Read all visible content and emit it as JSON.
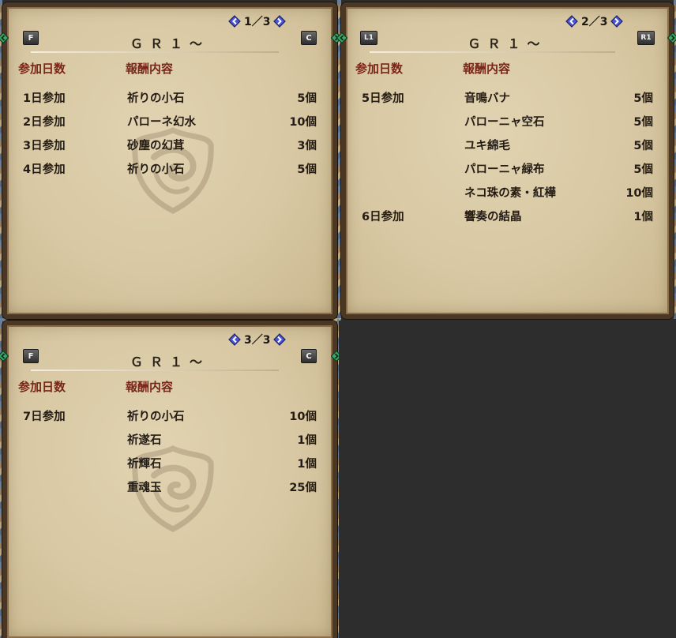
{
  "panels": [
    {
      "title": "ＧＲ１～",
      "page": "1／3",
      "left_key": "F",
      "right_key": "C",
      "col_day": "参加日数",
      "col_reward": "報酬内容",
      "rows": [
        {
          "day": "1日参加",
          "item": "祈りの小石",
          "qty": "5個"
        },
        {
          "day": "2日参加",
          "item": "パローネ幻水",
          "qty": "10個"
        },
        {
          "day": "3日参加",
          "item": "砂塵の幻茸",
          "qty": "3個"
        },
        {
          "day": "4日参加",
          "item": "祈りの小石",
          "qty": "5個"
        }
      ]
    },
    {
      "title": "ＧＲ１～",
      "page": "2／3",
      "left_key": "L1",
      "right_key": "R1",
      "col_day": "参加日数",
      "col_reward": "報酬内容",
      "rows": [
        {
          "day": "5日参加",
          "item": "音鳴バナ",
          "qty": "5個"
        },
        {
          "day": "",
          "item": "パローニャ空石",
          "qty": "5個"
        },
        {
          "day": "",
          "item": "ユキ綿毛",
          "qty": "5個"
        },
        {
          "day": "",
          "item": "パローニャ緑布",
          "qty": "5個"
        },
        {
          "day": "",
          "item": "ネコ珠の素・紅樺",
          "qty": "10個"
        },
        {
          "day": "6日参加",
          "item": "響奏の結晶",
          "qty": "1個"
        }
      ]
    },
    {
      "title": "ＧＲ１～",
      "page": "3／3",
      "left_key": "F",
      "right_key": "C",
      "col_day": "参加日数",
      "col_reward": "報酬内容",
      "rows": [
        {
          "day": "7日参加",
          "item": "祈りの小石",
          "qty": "10個"
        },
        {
          "day": "",
          "item": "祈遂石",
          "qty": "1個"
        },
        {
          "day": "",
          "item": "祈輝石",
          "qty": "1個"
        },
        {
          "day": "",
          "item": "重魂玉",
          "qty": "25個"
        }
      ]
    }
  ],
  "colors": {
    "header_text": "#7a2619",
    "body_text": "#241c14",
    "parchment": "#d8c8a3",
    "frame": "#4b3824",
    "arrow_blue": "#4a55d8",
    "gem_green": "#3aa86a"
  },
  "icons": {
    "page_prev": "diamond-arrow-left-icon",
    "page_next": "diamond-arrow-right-icon",
    "side_left": "green-gem-left-icon",
    "side_right": "green-gem-right-icon",
    "emblem": "guild-crest-emblem"
  }
}
